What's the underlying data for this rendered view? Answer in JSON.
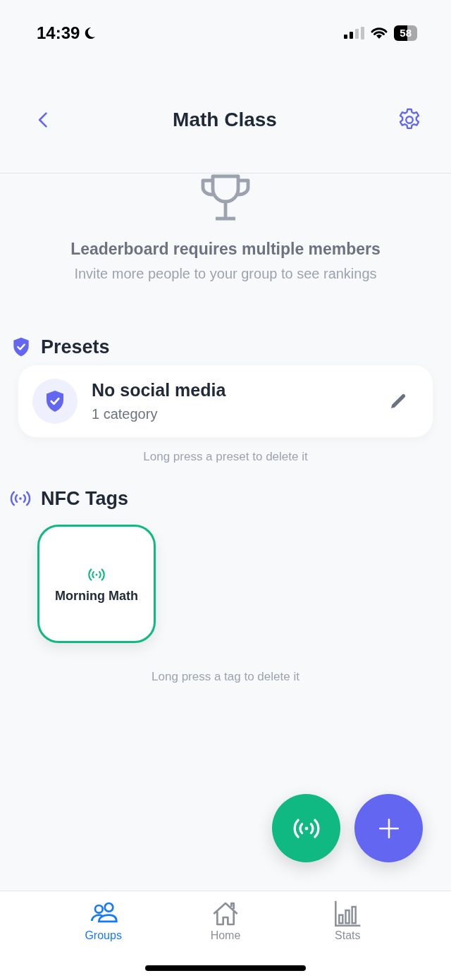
{
  "status_bar": {
    "time": "14:39",
    "battery": "58"
  },
  "nav": {
    "title": "Math Class"
  },
  "leaderboard": {
    "title": "Leaderboard requires multiple members",
    "subtitle": "Invite more people to your group to see rankings"
  },
  "presets": {
    "title": "Presets",
    "items": [
      {
        "name": "No social media",
        "detail": "1 category"
      }
    ],
    "hint": "Long press a preset to delete it"
  },
  "nfc_tags": {
    "title": "NFC Tags",
    "items": [
      {
        "name": "Morning Math",
        "color": "#10b981"
      }
    ],
    "hint": "Long press a tag to delete it"
  },
  "tab_bar": [
    {
      "label": "Groups",
      "kind": "groups",
      "selected": true
    },
    {
      "label": "Home",
      "kind": "home",
      "selected": false
    },
    {
      "label": "Stats",
      "kind": "stats",
      "selected": false
    }
  ]
}
